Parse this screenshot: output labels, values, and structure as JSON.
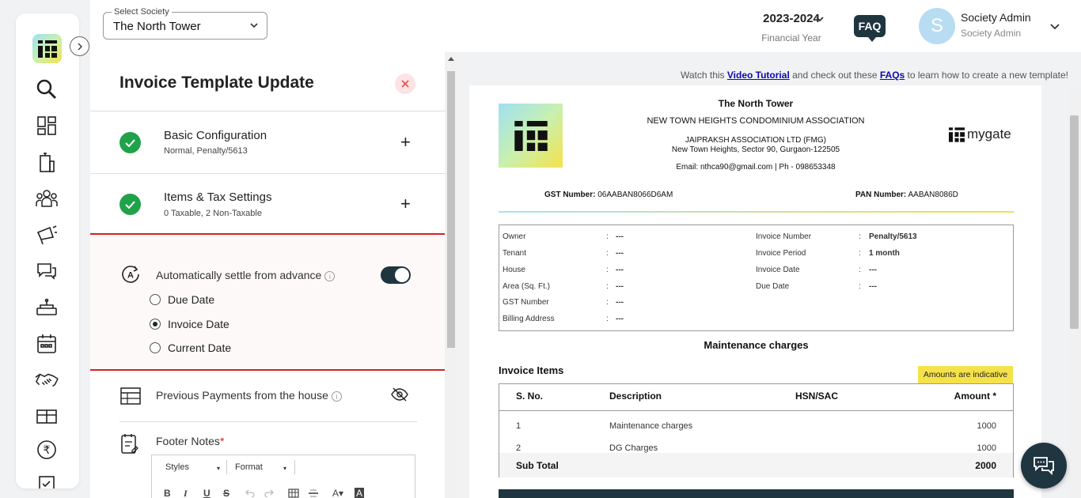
{
  "topbar": {
    "society_label": "Select Society",
    "society_value": "The North Tower",
    "financial_year": "2023-2024",
    "financial_year_label": "Financial Year",
    "faq": "FAQ",
    "avatar_letter": "S",
    "user_name": "Society Admin",
    "user_role": "Society Admin"
  },
  "editor": {
    "title": "Invoice Template Update",
    "sections": [
      {
        "title": "Basic Configuration",
        "subtitle": "Normal, Penalty/5613"
      },
      {
        "title": "Items & Tax Settings",
        "subtitle": "0 Taxable, 2 Non-Taxable"
      }
    ],
    "settle": {
      "label": "Automatically settle from advance",
      "enabled": true,
      "options": [
        {
          "label": "Due Date",
          "selected": false
        },
        {
          "label": "Invoice Date",
          "selected": true
        },
        {
          "label": "Current Date",
          "selected": false
        }
      ]
    },
    "previous_payments_label": "Previous Payments from the house",
    "footer_notes_label": "Footer Notes",
    "footer_notes_required": "*",
    "rte": {
      "styles": "Styles",
      "format": "Format",
      "bold": "B",
      "italic": "I",
      "underline": "U",
      "strike": "S"
    }
  },
  "tutorial": {
    "prefix": "Watch this ",
    "video_link": "Video Tutorial",
    "middle": " and check out these ",
    "faq_link": "FAQs",
    "suffix": " to learn how to create a new template!"
  },
  "preview": {
    "society_name": "The North Tower",
    "association": "NEW TOWN HEIGHTS CONDOMINIUM ASSOCIATION",
    "company": "JAIPRAKSH ASSOCIATION LTD (FMG)",
    "address": "New Town Heights, Sector 90, Gurgaon-122505",
    "contact": "Email: nthca90@gmail.com | Ph - 098653348",
    "brand": "mygate",
    "gst_label": "GST Number:",
    "gst_value": "06AABAN8066D6AM",
    "pan_label": "PAN Number:",
    "pan_value": "AABAN8086D",
    "info_left": [
      {
        "key": "Owner",
        "value": "---"
      },
      {
        "key": "Tenant",
        "value": "---"
      },
      {
        "key": "House",
        "value": "---"
      },
      {
        "key": "Area (Sq. Ft.)",
        "value": "---"
      },
      {
        "key": "GST Number",
        "value": "---"
      },
      {
        "key": "Billing Address",
        "value": "---"
      }
    ],
    "info_right": [
      {
        "key": "Invoice Number",
        "value": "Penalty/5613"
      },
      {
        "key": "Invoice Period",
        "value": "1 month"
      },
      {
        "key": "Invoice Date",
        "value": "---"
      },
      {
        "key": "Due Date",
        "value": "---"
      }
    ],
    "colon": ":",
    "section_title": "Maintenance charges",
    "items_title": "Invoice Items",
    "indicative": "Amounts are indicative",
    "table_headers": {
      "sno": "S. No.",
      "desc": "Description",
      "hsn": "HSN/SAC",
      "amount": "Amount *"
    },
    "rows": [
      {
        "sno": "1",
        "desc": "Maintenance charges",
        "amount": "1000"
      },
      {
        "sno": "2",
        "desc": "DG Charges",
        "amount": "1000"
      }
    ],
    "subtotal_label": "Sub Total",
    "subtotal_value": "2000"
  }
}
